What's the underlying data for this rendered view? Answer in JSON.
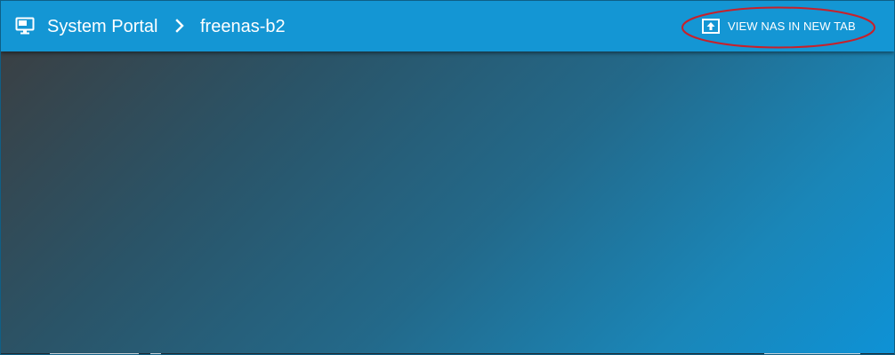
{
  "header": {
    "breadcrumb_root": "System Portal",
    "breadcrumb_current": "freenas-b2",
    "action_button_label": "VIEW NAS IN NEW TAB",
    "brand_icon": "monitor-icon",
    "separator_icon": "chevron-right-icon",
    "action_icon": "open-in-new-tab-icon"
  },
  "colors": {
    "header_bg": "#1496d4",
    "header_text": "#ffffff",
    "annotation_ellipse": "#c8202a",
    "content_gradient_start": "#3a4044",
    "content_gradient_end": "#0e92d6"
  }
}
